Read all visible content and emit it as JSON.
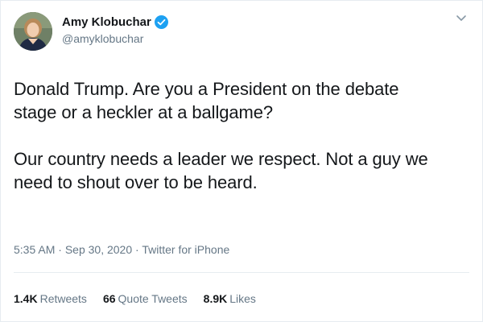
{
  "author": {
    "display_name": "Amy Klobuchar",
    "handle": "@amyklobuchar",
    "verified": true,
    "avatar_icon": "profile-photo"
  },
  "tweet": {
    "paragraphs": [
      "Donald Trump.  Are you a President on the debate\nstage or a heckler at a ballgame?",
      "Our country needs a leader we respect. Not a guy we\nneed to shout over to be heard."
    ]
  },
  "meta": {
    "time": "5:35 AM",
    "separator": " · ",
    "date": "Sep 30, 2020",
    "source": "Twitter for iPhone"
  },
  "stats": {
    "retweets": {
      "count": "1.4K",
      "label": "Retweets"
    },
    "quote_tweets": {
      "count": "66",
      "label": "Quote Tweets"
    },
    "likes": {
      "count": "8.9K",
      "label": "Likes"
    }
  },
  "colors": {
    "text": "#14171a",
    "secondary": "#657786",
    "verified": "#1da1f2",
    "divider": "#e6ecf0"
  }
}
